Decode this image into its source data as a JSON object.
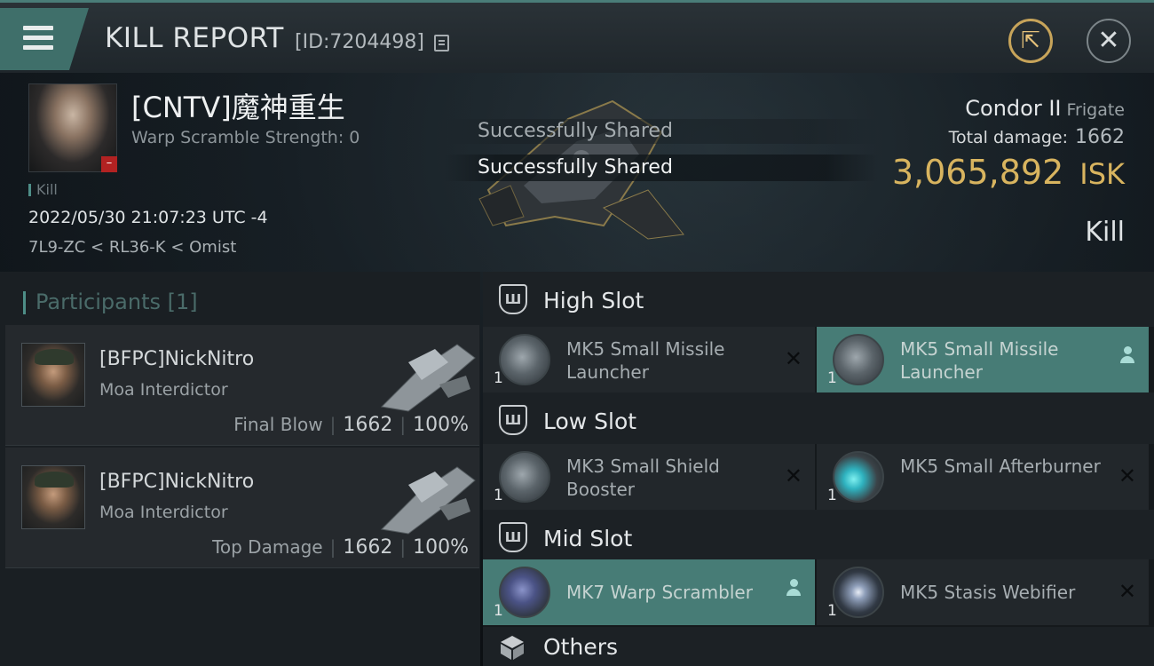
{
  "header": {
    "title": "KILL REPORT",
    "report_id": "[ID:7204498]",
    "menu_icon": "hamburger-menu-icon",
    "copy_icon": "copy-icon",
    "share_icon": "share-export-icon",
    "close_icon": "close-icon"
  },
  "victim": {
    "name": "[CNTV]魔神重生",
    "warp_scramble": "Warp Scramble Strength: 0",
    "kill_label": "Kill",
    "datetime": "2022/05/30 21:07:23 UTC -4",
    "location": "7L9-ZC < RL36-K < Omist",
    "badge": "–"
  },
  "toasts": [
    "Successfully Shared",
    "Successfully Shared"
  ],
  "ship": {
    "name": "Condor II",
    "class": "Frigate",
    "total_damage_label": "Total damage:",
    "total_damage": "1662",
    "isk_value": "3,065,892",
    "isk_label": "ISK",
    "kill_type": "Kill"
  },
  "participants": {
    "header": "Participants",
    "count": "[1]",
    "items": [
      {
        "name": "[BFPC]NickNitro",
        "ship": "Moa Interdictor",
        "role": "Final Blow",
        "damage": "1662",
        "percent": "100%"
      },
      {
        "name": "[BFPC]NickNitro",
        "ship": "Moa Interdictor",
        "role": "Top Damage",
        "damage": "1662",
        "percent": "100%"
      }
    ]
  },
  "slots": {
    "high": {
      "label": "High Slot",
      "modules": [
        {
          "name": "MK5 Small Missile Launcher",
          "qty": "1",
          "status": "destroyed"
        },
        {
          "name": "MK5 Small Missile Launcher",
          "qty": "1",
          "status": "dropped"
        }
      ]
    },
    "low": {
      "label": "Low Slot",
      "modules": [
        {
          "name": "MK3 Small Shield Booster",
          "qty": "1",
          "status": "destroyed"
        },
        {
          "name": "MK5 Small Afterburner",
          "qty": "1",
          "status": "destroyed"
        }
      ]
    },
    "mid": {
      "label": "Mid Slot",
      "modules": [
        {
          "name": "MK7 Warp Scrambler",
          "qty": "1",
          "status": "dropped"
        },
        {
          "name": "MK5 Stasis Webifier",
          "qty": "1",
          "status": "destroyed"
        }
      ]
    },
    "others": {
      "label": "Others"
    }
  },
  "colors": {
    "accent": "#477c76",
    "isk": "#d8b45f",
    "danger": "#b22222"
  }
}
